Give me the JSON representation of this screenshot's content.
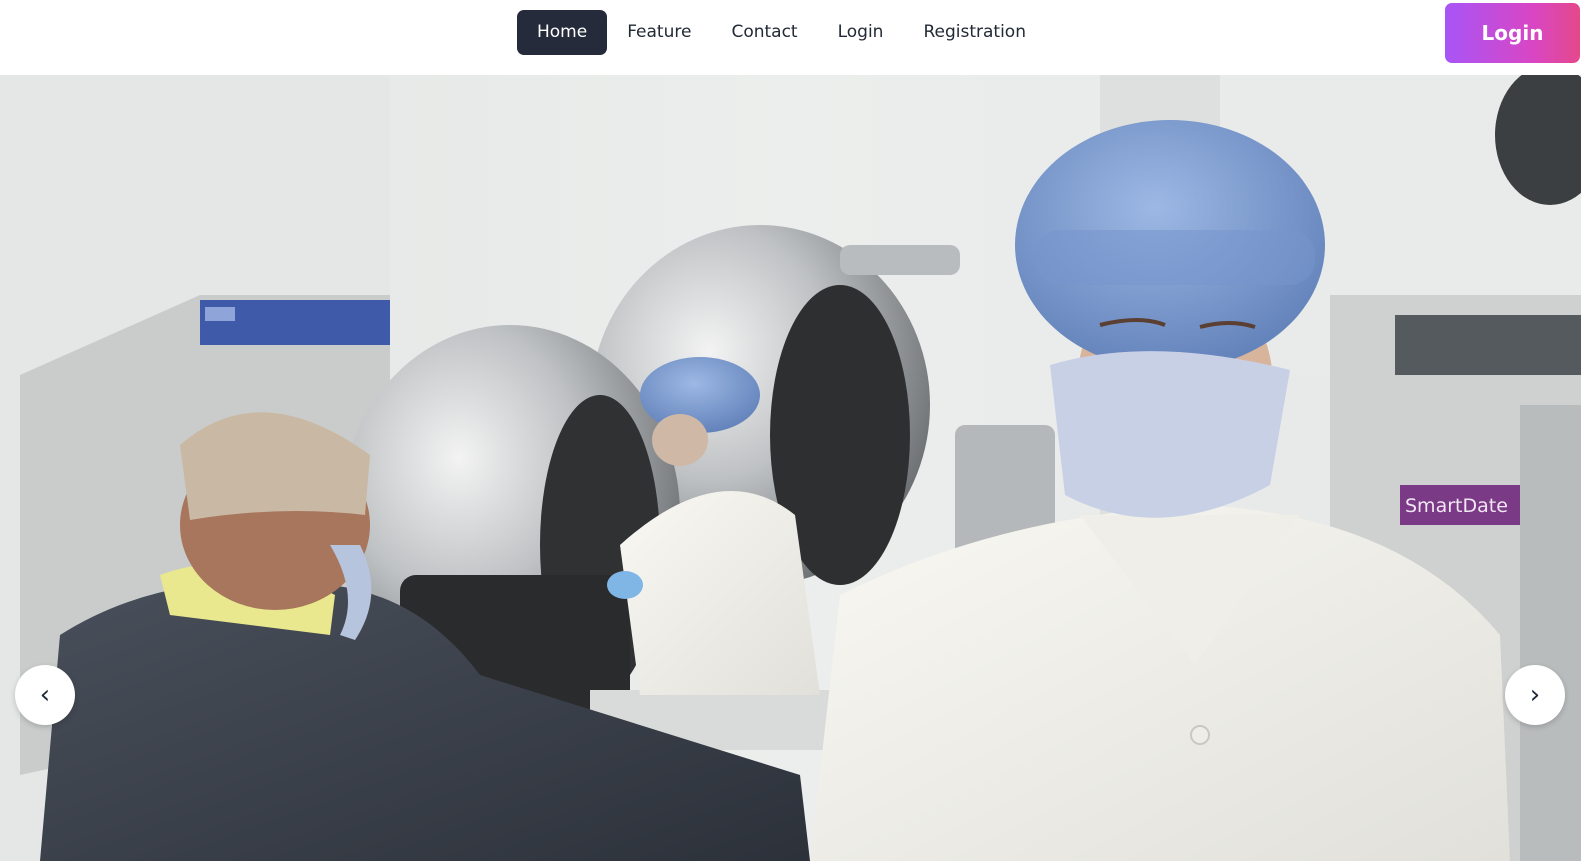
{
  "nav": {
    "items": [
      {
        "label": "Home",
        "active": true
      },
      {
        "label": "Feature",
        "active": false
      },
      {
        "label": "Contact",
        "active": false
      },
      {
        "label": "Login",
        "active": false
      },
      {
        "label": "Registration",
        "active": false
      }
    ],
    "login_button": "Login"
  },
  "hero": {
    "machine_label": "SmartDate",
    "prev_arrow": "‹",
    "next_arrow": "›"
  },
  "colors": {
    "nav_active_bg": "#252b3b",
    "login_gradient_start": "#a855f7",
    "login_gradient_end": "#e4488b"
  }
}
